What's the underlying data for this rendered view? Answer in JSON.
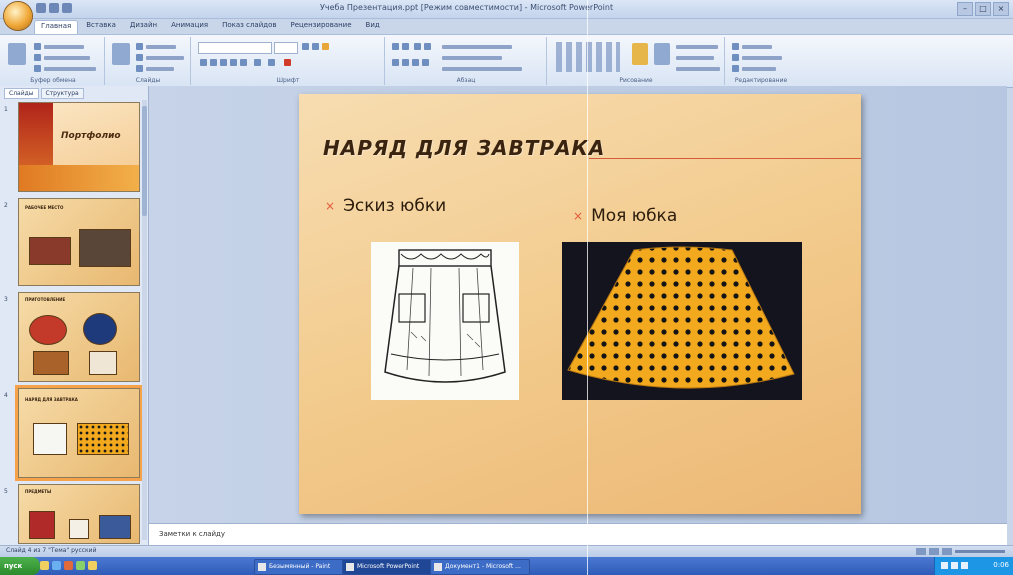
{
  "window": {
    "title": "Учеба Презентация.ppt [Режим совместимости] - Microsoft PowerPoint",
    "controls": [
      "–",
      "□",
      "×"
    ]
  },
  "ribbon": {
    "tabs": [
      "Главная",
      "Вставка",
      "Дизайн",
      "Анимация",
      "Показ слайдов",
      "Рецензирование",
      "Вид"
    ],
    "active_tab": "Главная",
    "groups": [
      "Буфер обмена",
      "Слайды",
      "Шрифт",
      "Абзац",
      "Рисование",
      "Редактирование"
    ]
  },
  "slides_panel": {
    "tabs": [
      "Слайды",
      "Структура"
    ],
    "thumbnails": [
      {
        "number": "1",
        "title": "Портфолио"
      },
      {
        "number": "2",
        "title": "РАБОЧЕЕ МЕСТО"
      },
      {
        "number": "3",
        "title": "ПРИГОТОВЛЕНИЕ"
      },
      {
        "number": "4",
        "title": "НАРЯД ДЛЯ ЗАВТРАКА"
      },
      {
        "number": "5",
        "title": "ПРЕДМЕТЫ"
      }
    ],
    "selected_index": 4
  },
  "slide": {
    "title": "НАРЯД ДЛЯ ЗАВТРАКА",
    "bullet_left": "Эскиз юбки",
    "bullet_right": "Моя юбка",
    "bullet_marker": "×"
  },
  "notes": {
    "placeholder": "Заметки к слайду"
  },
  "status": {
    "text": "Слайд 4 из 7    \"Тема\"    русский"
  },
  "taskbar": {
    "start": "пуск",
    "tasks": [
      "Безымянный - Paint",
      "Microsoft PowerPoint",
      "Документ1 - Microsoft ..."
    ],
    "active_task": "Microsoft PowerPoint",
    "clock": "0:06"
  },
  "colors": {
    "accent": "#e05a3a",
    "slide_background": "#f2c98a",
    "title_text": "#3a2410",
    "selection": "#f5a24a",
    "skirt_dots": "#141414",
    "skirt_fabric": "#f2a91e"
  }
}
